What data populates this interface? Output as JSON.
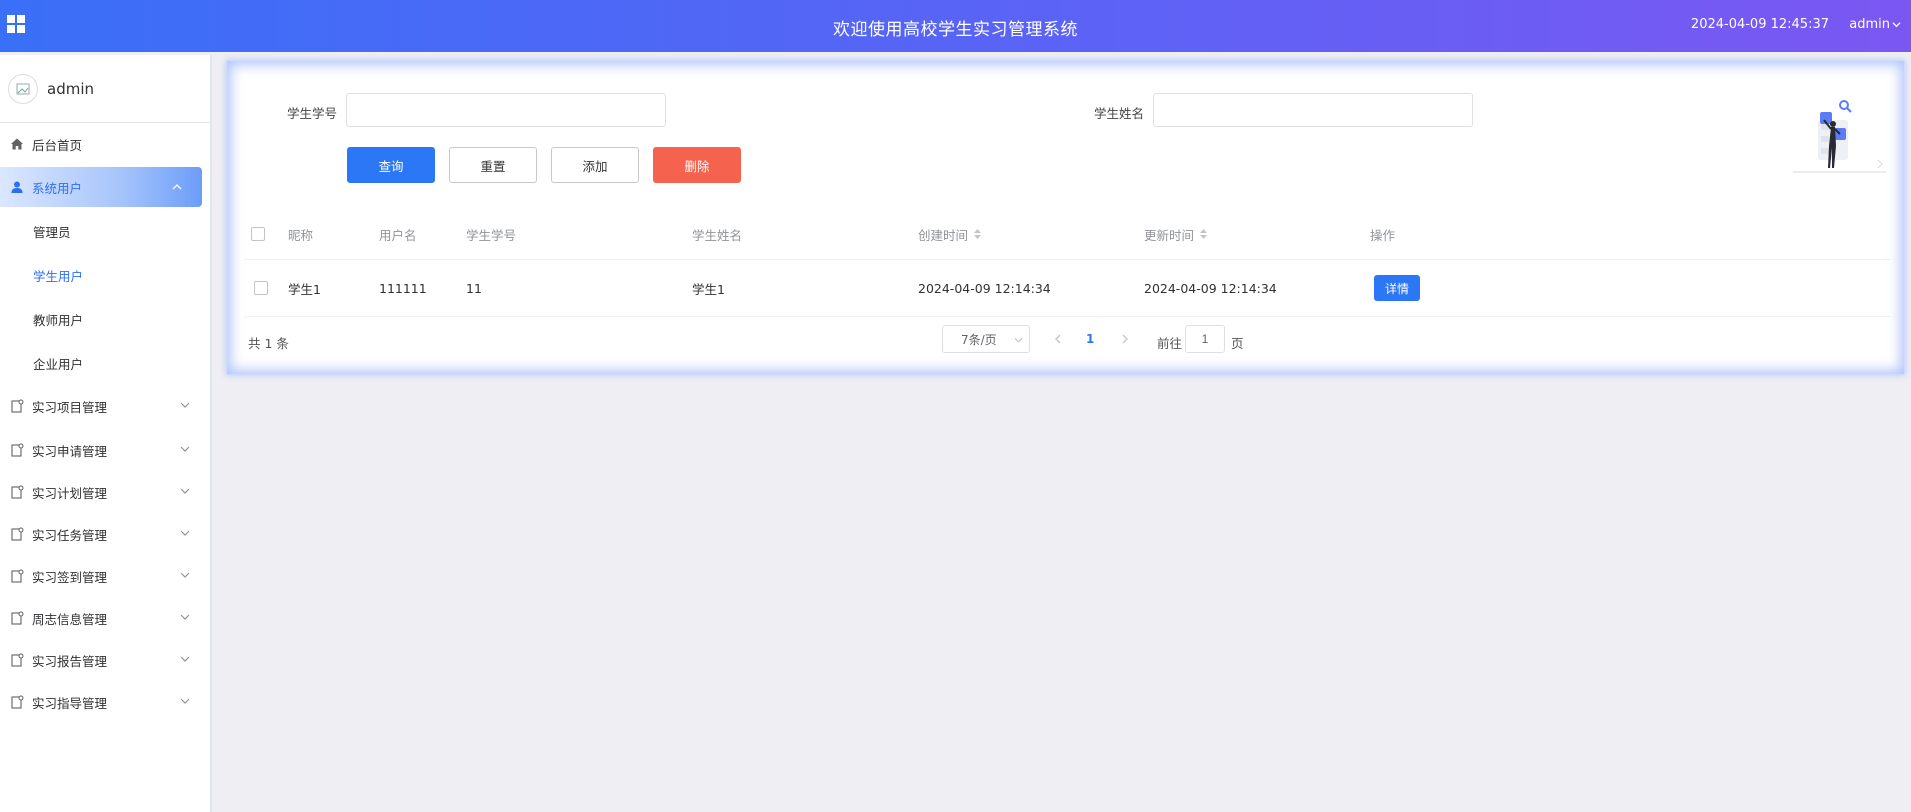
{
  "header": {
    "title": "欢迎使用高校学生实习管理系统",
    "datetime": "2024-04-09 12:45:37",
    "user": "admin"
  },
  "sidebar": {
    "username": "admin",
    "items": [
      {
        "label": "后台首页",
        "icon": "home-icon"
      },
      {
        "label": "系统用户",
        "icon": "user-icon",
        "expanded": true,
        "children": [
          "管理员",
          "学生用户",
          "教师用户",
          "企业用户"
        ],
        "selected_child": "学生用户"
      },
      {
        "label": "实习项目管理",
        "icon": "doc-icon"
      },
      {
        "label": "实习申请管理",
        "icon": "doc-icon"
      },
      {
        "label": "实习计划管理",
        "icon": "doc-icon"
      },
      {
        "label": "实习任务管理",
        "icon": "doc-icon"
      },
      {
        "label": "实习签到管理",
        "icon": "doc-icon"
      },
      {
        "label": "周志信息管理",
        "icon": "doc-icon"
      },
      {
        "label": "实习报告管理",
        "icon": "doc-icon"
      },
      {
        "label": "实习指导管理",
        "icon": "doc-icon"
      }
    ]
  },
  "search": {
    "student_no_label": "学生学号",
    "student_no_value": "",
    "student_name_label": "学生姓名",
    "student_name_value": "",
    "query_label": "查询",
    "reset_label": "重置",
    "add_label": "添加",
    "delete_label": "删除"
  },
  "table": {
    "columns": [
      "昵称",
      "用户名",
      "学生学号",
      "学生姓名",
      "创建时间",
      "更新时间",
      "操作"
    ],
    "rows": [
      {
        "nickname": "学生1",
        "username": "111111",
        "student_no": "11",
        "student_name": "学生1",
        "created": "2024-04-09 12:14:34",
        "updated": "2024-04-09 12:14:34",
        "action": "详情"
      }
    ]
  },
  "pagination": {
    "total_text": "共 1 条",
    "page_size": "7条/页",
    "current_page": "1",
    "goto_label": "前往",
    "goto_value": "1",
    "goto_suffix": "页"
  },
  "colors": {
    "primary": "#2b77f5",
    "danger": "#f5624d",
    "header_start": "#3a6ff7",
    "header_end": "#7b57f2"
  }
}
